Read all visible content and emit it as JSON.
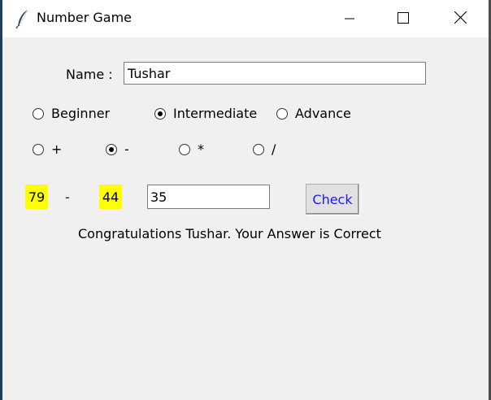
{
  "window": {
    "title": "Number Game"
  },
  "form": {
    "name_label": "Name :",
    "name_value": "Tushar"
  },
  "levels": [
    {
      "label": "Beginner",
      "checked": false
    },
    {
      "label": "Intermediate",
      "checked": true
    },
    {
      "label": "Advance",
      "checked": false
    }
  ],
  "operations": [
    {
      "label": "+",
      "checked": false
    },
    {
      "label": "-",
      "checked": true
    },
    {
      "label": "*",
      "checked": false
    },
    {
      "label": "/",
      "checked": false
    }
  ],
  "problem": {
    "num1": "79",
    "operator": "-",
    "num2": "44",
    "answer": "35",
    "check_label": "Check",
    "message": "Congratulations Tushar. Your Answer is Correct"
  },
  "colors": {
    "highlight": "#ffff00",
    "check_text": "#1a1aff"
  },
  "icons": {
    "app": "feather-icon",
    "minimize": "minimize-icon",
    "maximize": "maximize-icon",
    "close": "close-icon"
  }
}
